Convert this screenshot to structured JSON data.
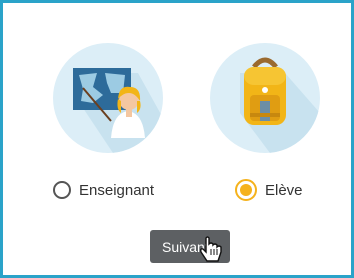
{
  "roles": [
    {
      "id": "teacher",
      "label": "Enseignant",
      "checked": false,
      "illustration": "teacher-map-icon"
    },
    {
      "id": "student",
      "label": "Elève",
      "checked": true,
      "illustration": "backpack-icon"
    }
  ],
  "next_button": {
    "label": "Suivant"
  },
  "colors": {
    "frame": "#2aa3c9",
    "circle_bg": "#dceef7",
    "radio_selected": "#f5b21c",
    "button_bg": "#5d6063"
  }
}
